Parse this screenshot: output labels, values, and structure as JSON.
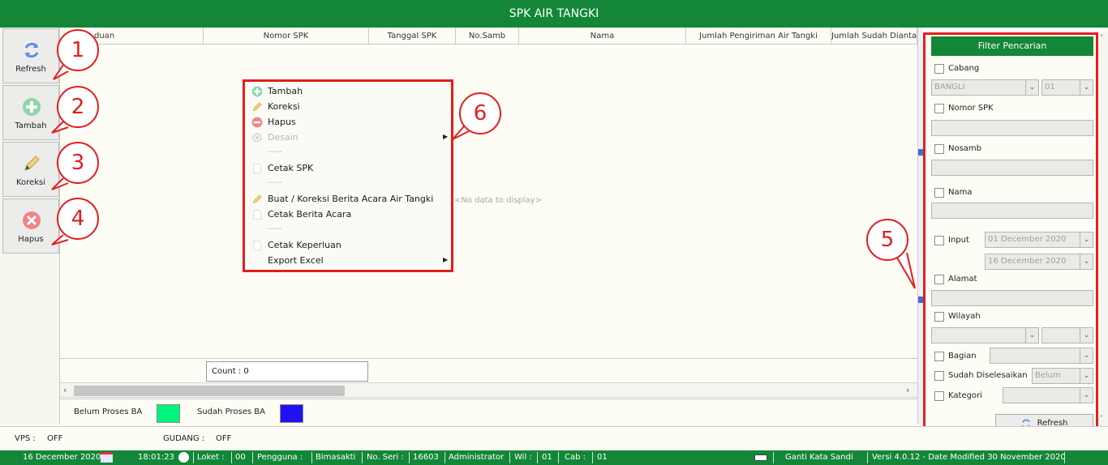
{
  "title": "SPK AIR TANGKI",
  "toolbar": {
    "refresh": "Refresh",
    "tambah": "Tambah",
    "koreksi": "Koreksi",
    "hapus": "Hapus"
  },
  "grid": {
    "columns": [
      "duan",
      "Nomor SPK",
      "Tanggal SPK",
      "No.Samb",
      "Nama",
      "Jumlah Pengiriman Air Tangki",
      "Jumlah Sudah Diantar"
    ],
    "empty_text": "<No data to display>",
    "count": "Count : 0"
  },
  "legend": {
    "belum_label": "Belum Proses BA",
    "belum_color": "#00f47d",
    "sudah_label": "Sudah Proses BA",
    "sudah_color": "#2210f5"
  },
  "context_menu": {
    "tambah": "Tambah",
    "koreksi": "Koreksi",
    "hapus": "Hapus",
    "desain": "Desain",
    "sep1": "-----",
    "cetak_spk": "Cetak SPK",
    "sep2": "-----",
    "buat_koreksi": "Buat / Koreksi  Berita Acara Air Tangki",
    "cetak_berita": "Cetak Berita Acara",
    "sep3": "-----",
    "cetak_keperluan": "Cetak Keperluan",
    "export_excel": "Export Excel"
  },
  "filter": {
    "header": "Filter Pencarian",
    "cabang_label": "Cabang",
    "cabang_value": "BANGLI",
    "cabang_code": "01",
    "nomor_spk_label": "Nomor SPK",
    "nosamb_label": "Nosamb",
    "nama_label": "Nama",
    "input_label": "Input",
    "date_from": "01 December 2020",
    "date_to": "16 December 2020",
    "alamat_label": "Alamat",
    "wilayah_label": "Wilayah",
    "bagian_label": "Bagian",
    "sudah_label": "Sudah Diselesaikan",
    "sudah_value": "Belum",
    "kategori_label": "Kategori",
    "refresh": "Refresh"
  },
  "callouts": [
    "1",
    "2",
    "3",
    "4",
    "5",
    "6"
  ],
  "status": {
    "vps_label": "VPS :",
    "vps_value": "OFF",
    "gudang_label": "GUDANG :",
    "gudang_value": "OFF"
  },
  "bottom": {
    "date": "16 December 2020",
    "time": "18:01:23",
    "loket_label": "Loket :",
    "loket_value": "00",
    "pengguna_label": "Pengguna :",
    "pengguna_value": "Bimasakti",
    "noseri_label": "No. Seri :",
    "noseri_value": "16603",
    "role": "Administrator",
    "wil_label": "Wil :",
    "wil_value": "01",
    "cab_label": "Cab :",
    "cab_value": "01",
    "ganti": "Ganti Kata Sandi",
    "versi": "Versi 4.0.12 - Date Modified 30 November 2020"
  }
}
